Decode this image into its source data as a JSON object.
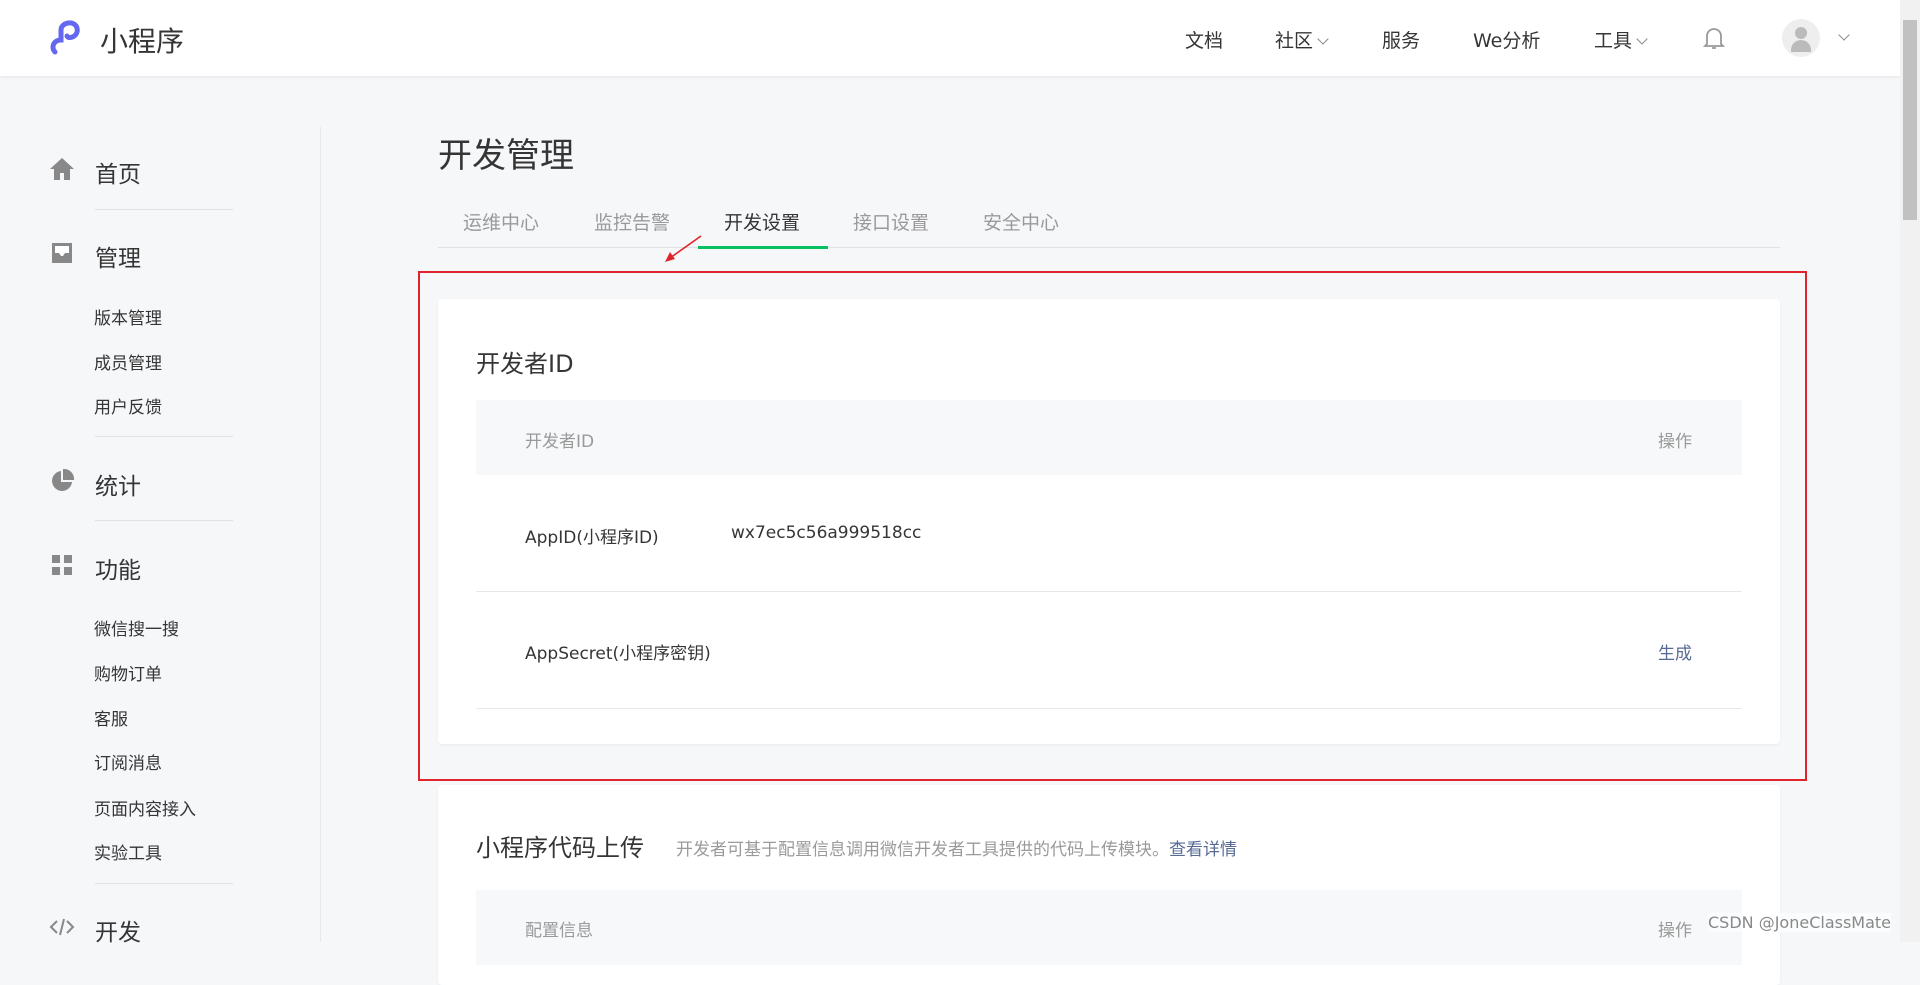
{
  "header": {
    "logo_text": "小程序",
    "nav": [
      {
        "label": "文档"
      },
      {
        "label": "社区",
        "dropdown": true
      },
      {
        "label": "服务"
      },
      {
        "label": "We分析"
      },
      {
        "label": "工具",
        "dropdown": true
      }
    ]
  },
  "sidebar": {
    "sections": [
      {
        "label": "首页",
        "icon": "home-icon"
      },
      {
        "label": "管理",
        "icon": "inbox-icon",
        "items": [
          "版本管理",
          "成员管理",
          "用户反馈"
        ]
      },
      {
        "label": "统计",
        "icon": "pie-chart-icon"
      },
      {
        "label": "功能",
        "icon": "grid-icon",
        "items": [
          "微信搜一搜",
          "购物订单",
          "客服",
          "订阅消息",
          "页面内容接入",
          "实验工具"
        ]
      },
      {
        "label": "开发",
        "icon": "code-icon"
      }
    ]
  },
  "main": {
    "title": "开发管理",
    "tabs": [
      "运维中心",
      "监控告警",
      "开发设置",
      "接口设置",
      "安全中心"
    ],
    "active_tab": 2,
    "developer_id": {
      "heading": "开发者ID",
      "col_left": "开发者ID",
      "col_right": "操作",
      "rows": [
        {
          "label": "AppID(小程序ID)",
          "value": "wx7ec5c56a999518cc",
          "action": ""
        },
        {
          "label": "AppSecret(小程序密钥)",
          "value": "",
          "action": "生成"
        }
      ]
    },
    "upload": {
      "heading": "小程序代码上传",
      "desc": "开发者可基于配置信息调用微信开发者工具提供的代码上传模块。",
      "link": "查看详情",
      "col_left": "配置信息",
      "col_right": "操作"
    }
  },
  "watermark": "CSDN @JoneClassMate",
  "colors": {
    "accent": "#07c160",
    "link": "#576b95",
    "highlight": "#e0242b"
  }
}
